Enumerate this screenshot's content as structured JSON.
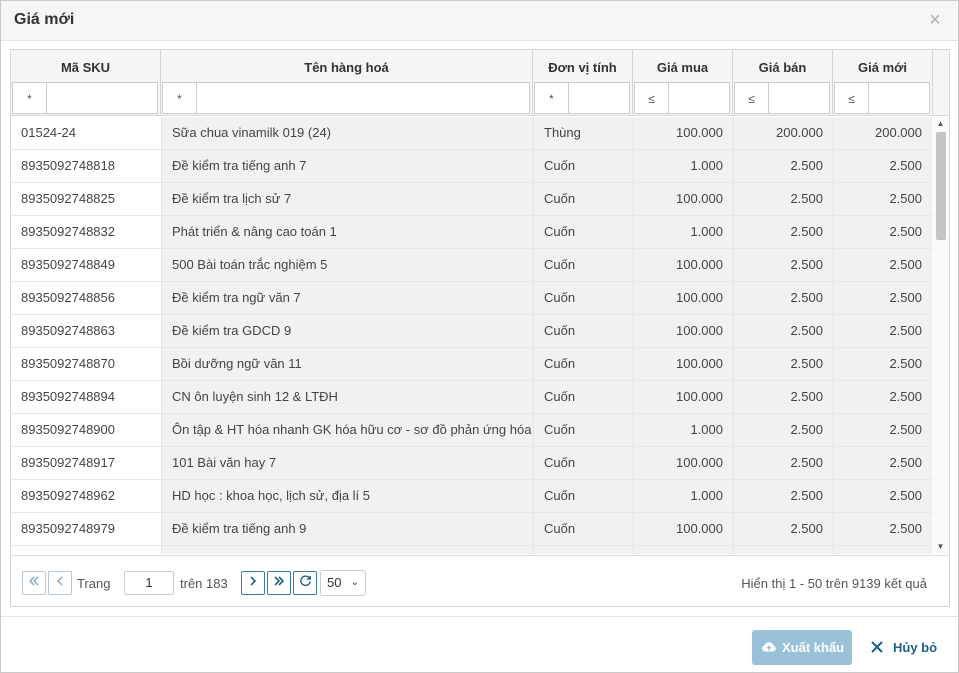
{
  "dialog": {
    "title": "Giá mới",
    "close_symbol": "×"
  },
  "columns": [
    {
      "header": "Mã SKU",
      "filter_op": "*",
      "filter_value": ""
    },
    {
      "header": "Tên hàng hoá",
      "filter_op": "*",
      "filter_value": ""
    },
    {
      "header": "Đơn vị tính",
      "filter_op": "*",
      "filter_value": ""
    },
    {
      "header": "Giá mua",
      "filter_op": "≤",
      "filter_value": ""
    },
    {
      "header": "Giá bán",
      "filter_op": "≤",
      "filter_value": ""
    },
    {
      "header": "Giá mới",
      "filter_op": "≤",
      "filter_value": ""
    }
  ],
  "rows": [
    [
      "01524-24",
      "Sữa chua vinamilk 019 (24)",
      "Thùng",
      "100.000",
      "200.000",
      "200.000"
    ],
    [
      "8935092748818",
      "Đề kiểm tra tiếng anh 7",
      "Cuốn",
      "1.000",
      "2.500",
      "2.500"
    ],
    [
      "8935092748825",
      "Đề kiểm tra lịch sử 7",
      "Cuốn",
      "100.000",
      "2.500",
      "2.500"
    ],
    [
      "8935092748832",
      "Phát triển & nâng cao toán 1",
      "Cuốn",
      "1.000",
      "2.500",
      "2.500"
    ],
    [
      "8935092748849",
      "500 Bài toán trắc nghiệm 5",
      "Cuốn",
      "100.000",
      "2.500",
      "2.500"
    ],
    [
      "8935092748856",
      "Đề kiểm tra ngữ văn 7",
      "Cuốn",
      "100.000",
      "2.500",
      "2.500"
    ],
    [
      "8935092748863",
      "Đề kiểm tra GDCD 9",
      "Cuốn",
      "100.000",
      "2.500",
      "2.500"
    ],
    [
      "8935092748870",
      "Bồi dưỡng ngữ văn 11",
      "Cuốn",
      "100.000",
      "2.500",
      "2.500"
    ],
    [
      "8935092748894",
      "CN ôn luyện sinh 12 & LTĐH",
      "Cuốn",
      "100.000",
      "2.500",
      "2.500"
    ],
    [
      "8935092748900",
      "Ôn tập & HT hóa nhanh GK hóa hữu cơ - sơ đồ phản ứng hóa",
      "Cuốn",
      "1.000",
      "2.500",
      "2.500"
    ],
    [
      "8935092748917",
      "101 Bài văn hay 7",
      "Cuốn",
      "100.000",
      "2.500",
      "2.500"
    ],
    [
      "8935092748962",
      "HD học : khoa học, lịch sử, địa lí 5",
      "Cuốn",
      "1.000",
      "2.500",
      "2.500"
    ],
    [
      "8935092748979",
      "Đề kiểm tra tiếng anh 9",
      "Cuốn",
      "100.000",
      "2.500",
      "2.500"
    ]
  ],
  "pager": {
    "page_label": "Trang",
    "page_value": "1",
    "of_label": "trên 183",
    "page_size": "50",
    "info": "Hiển thị 1 - 50 trên 9139 kết quả"
  },
  "footer": {
    "export_label": "Xuất khẩu",
    "cancel_label": "Hủy bỏ"
  },
  "colors": {
    "accent": "#1f5f8b",
    "export_bg": "#99c1d7",
    "header_bg": "#f5f5f5"
  }
}
